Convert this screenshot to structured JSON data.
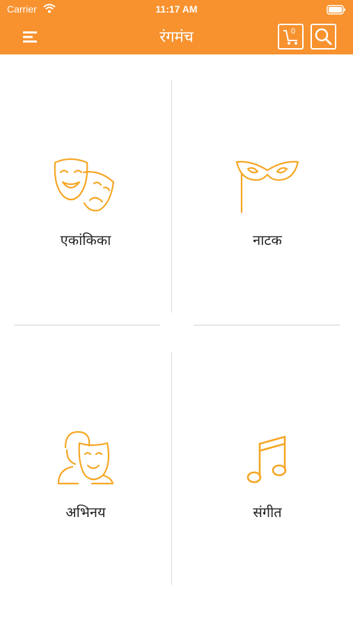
{
  "status_bar": {
    "carrier": "Carrier",
    "time": "11:17 AM"
  },
  "nav": {
    "title": "रंगमंच",
    "cart_count": "0",
    "menu_icon": "hamburger-menu-icon",
    "cart_icon": "cart-icon",
    "search_icon": "search-icon"
  },
  "colors": {
    "accent": "#f7922f",
    "icon": "#f5a623",
    "text": "#222222"
  },
  "categories": [
    {
      "label": "एकांकिका",
      "icon": "comedy-tragedy-masks-icon"
    },
    {
      "label": "नाटक",
      "icon": "masquerade-mask-icon"
    },
    {
      "label": "अभिनय",
      "icon": "actor-with-mask-icon"
    },
    {
      "label": "संगीत",
      "icon": "music-note-icon"
    }
  ]
}
